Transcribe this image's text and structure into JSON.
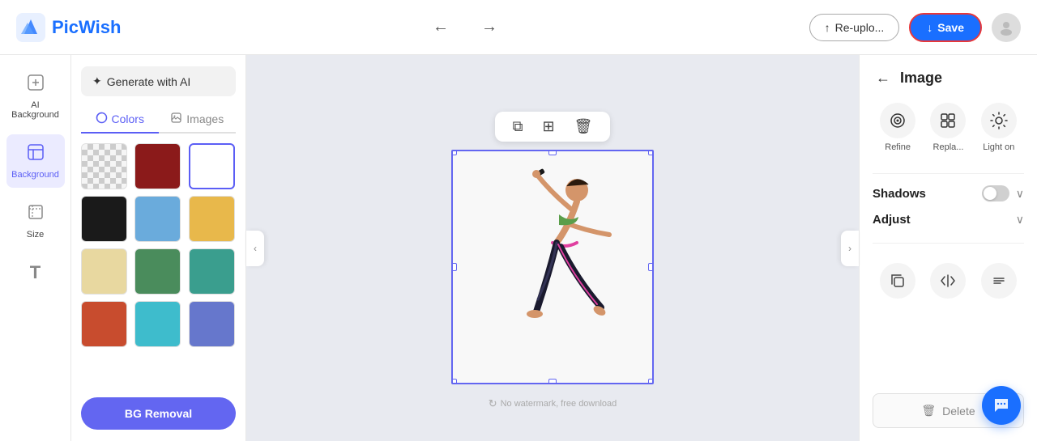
{
  "app": {
    "name": "PicWish",
    "logo_color": "#1a6fff"
  },
  "topbar": {
    "reupload_label": "Re-uplo...",
    "save_label": "Save",
    "undo_icon": "←",
    "redo_icon": "→"
  },
  "left_sidebar": {
    "items": [
      {
        "id": "ai-background",
        "label": "AI\nBackground",
        "icon": "✦",
        "active": false
      },
      {
        "id": "background",
        "label": "Background",
        "icon": "⊘",
        "active": true
      },
      {
        "id": "size",
        "label": "Size",
        "icon": "⊡",
        "active": false
      },
      {
        "id": "text",
        "label": "T",
        "icon": "T",
        "active": false
      }
    ]
  },
  "panel": {
    "generate_ai_label": "Generate with AI",
    "tabs": [
      {
        "id": "colors",
        "label": "Colors",
        "active": true
      },
      {
        "id": "images",
        "label": "Images",
        "active": false
      }
    ],
    "colors": [
      {
        "id": "transparent",
        "type": "transparent",
        "selected": false
      },
      {
        "id": "dark-red",
        "hex": "#8b1a1a",
        "selected": false
      },
      {
        "id": "white",
        "hex": "#ffffff",
        "selected": true
      },
      {
        "id": "black",
        "hex": "#1a1a1a",
        "selected": false
      },
      {
        "id": "light-blue",
        "hex": "#6aabdc",
        "selected": false
      },
      {
        "id": "yellow",
        "hex": "#e8b84b",
        "selected": false
      },
      {
        "id": "wheat",
        "hex": "#e8d8a0",
        "selected": false
      },
      {
        "id": "green",
        "hex": "#4a8c5c",
        "selected": false
      },
      {
        "id": "teal",
        "hex": "#3a9e8e",
        "selected": false
      },
      {
        "id": "orange-red",
        "hex": "#c84c2e",
        "selected": false
      },
      {
        "id": "cyan",
        "hex": "#3ebccc",
        "selected": false
      },
      {
        "id": "medium-blue",
        "hex": "#6677cc",
        "selected": false
      }
    ],
    "bg_removal_label": "BG Removal"
  },
  "canvas": {
    "toolbar": {
      "copy_icon": "⧉",
      "grid_icon": "⊞",
      "delete_icon": "🗑"
    },
    "watermark_text": "No watermark, free download"
  },
  "right_panel": {
    "back_label": "←",
    "title": "Image",
    "tools": [
      {
        "id": "refine",
        "label": "Refine",
        "icon": "◎"
      },
      {
        "id": "replace",
        "label": "Repla...",
        "icon": "⊞"
      },
      {
        "id": "light-on",
        "label": "Light on",
        "icon": "☀"
      }
    ],
    "shadows_label": "Shadows",
    "adjust_label": "Adjust",
    "bottom_icons": [
      {
        "id": "copy",
        "icon": "⧉"
      },
      {
        "id": "flip",
        "icon": "⇔"
      },
      {
        "id": "align",
        "icon": "≡"
      }
    ],
    "delete_label": "Delete"
  },
  "chat_bubble": {
    "icon": "💬"
  }
}
